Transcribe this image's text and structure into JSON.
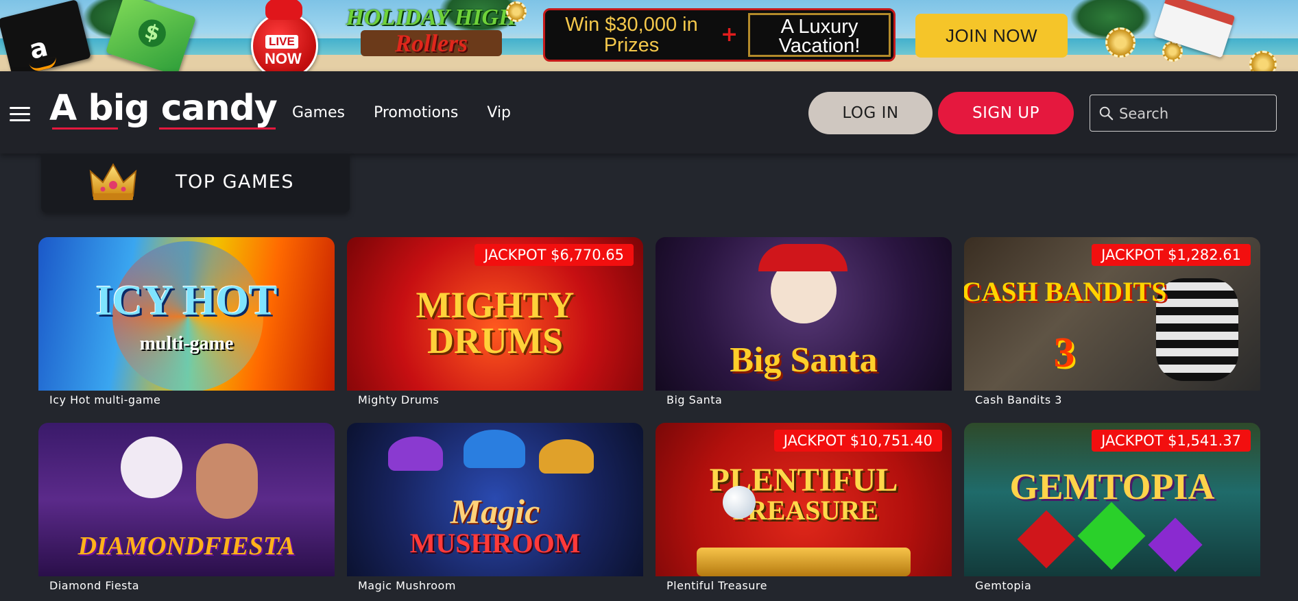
{
  "promo": {
    "gift_card_text": "amazon",
    "live_label": "LIVE",
    "now_label": "NOW",
    "event_line1": "HOLIDAY HIGH",
    "event_line2": "Rollers",
    "prize_text": "Win $30,000 in Prizes",
    "plus": "+",
    "vacation_text": "A Luxury Vacation!",
    "join_label": "JOIN NOW"
  },
  "header": {
    "logo": "A big candy",
    "nav": [
      "Games",
      "Promotions",
      "Vip"
    ],
    "login_label": "LOG IN",
    "signup_label": "SIGN UP",
    "search_placeholder": "Search"
  },
  "section": {
    "title": "TOP GAMES"
  },
  "games": [
    {
      "title": "Icy Hot multi-game",
      "jackpot": "",
      "art": "ICY HOT",
      "art_sub": "multi-game"
    },
    {
      "title": "Mighty Drums",
      "jackpot": "JACKPOT $6,770.65",
      "art": "MIGHTY",
      "art_sub": "DRUMS"
    },
    {
      "title": "Big Santa",
      "jackpot": "",
      "art": "Big Santa",
      "art_sub": ""
    },
    {
      "title": "Cash Bandits 3",
      "jackpot": "JACKPOT $1,282.61",
      "art": "CASH BANDITS",
      "art_sub": "3"
    },
    {
      "title": "Diamond Fiesta",
      "jackpot": "",
      "art": "DIAMONDFIESTA",
      "art_sub": ""
    },
    {
      "title": "Magic Mushroom",
      "jackpot": "",
      "art": "Magic",
      "art_sub": "MUSHROOM"
    },
    {
      "title": "Plentiful Treasure",
      "jackpot": "JACKPOT $10,751.40",
      "art": "PLENTIFUL",
      "art_sub": "TREASURE"
    },
    {
      "title": "Gemtopia",
      "jackpot": "JACKPOT $1,541.37",
      "art": "GEMTOPIA",
      "art_sub": ""
    }
  ],
  "colors": {
    "background": "#23262d",
    "header": "#202228",
    "accent_red": "#e5183e",
    "jackpot_red": "#f20f0f",
    "join_yellow": "#f5c529",
    "login_gray": "#cfc7c0"
  },
  "icons": [
    "menu-icon",
    "search-icon",
    "crown-icon"
  ]
}
